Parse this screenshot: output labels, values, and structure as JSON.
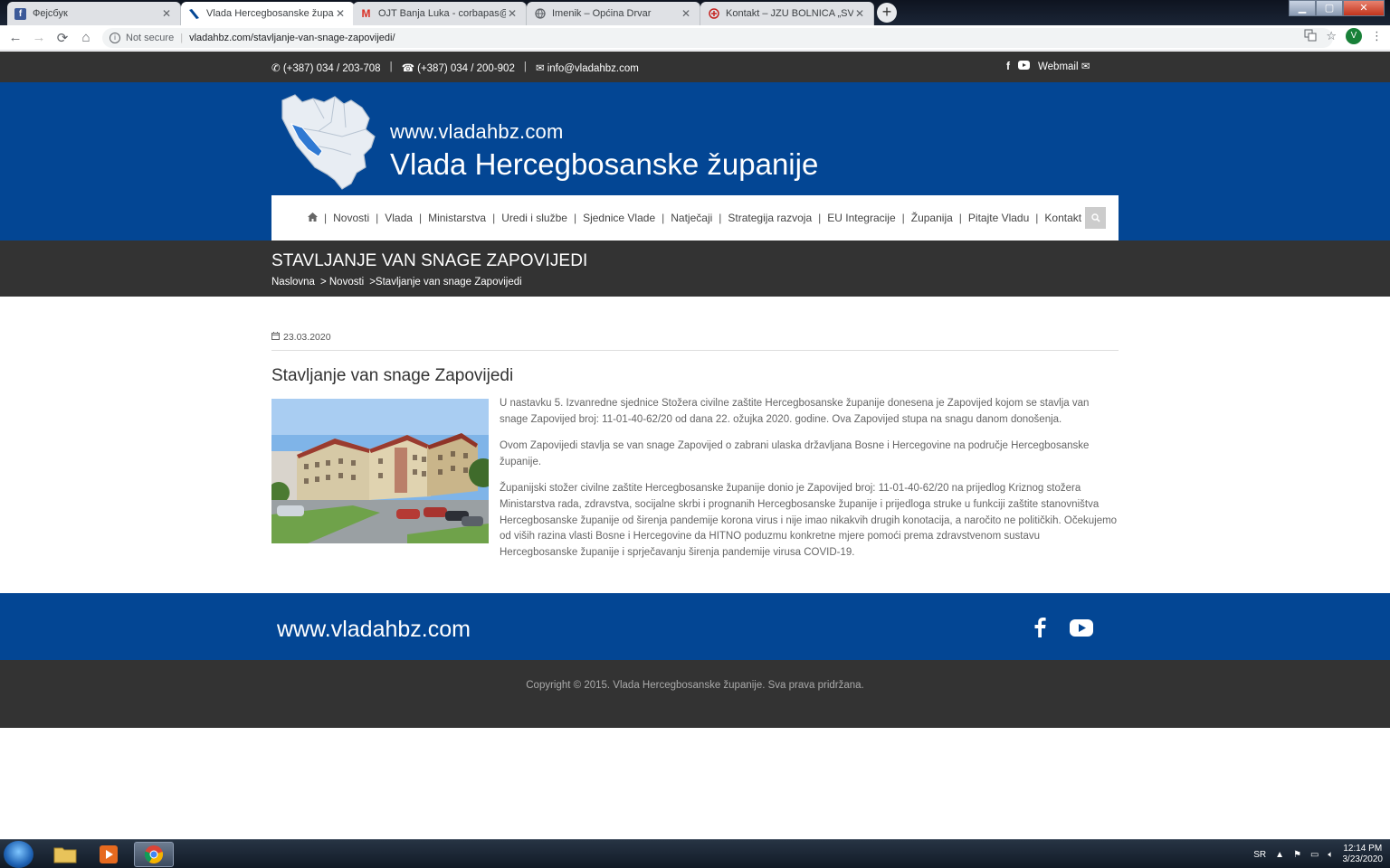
{
  "browser": {
    "tabs": [
      {
        "title": "Фејсбук",
        "icon": "facebook-icon"
      },
      {
        "title": "Vlada Hercegbosanske županije",
        "icon": "site-icon"
      },
      {
        "title": "OJT Banja Luka - corbapas@gma",
        "icon": "gmail-icon"
      },
      {
        "title": "Imenik – Općina Drvar",
        "icon": "globe-icon"
      },
      {
        "title": "Kontakt – JZU BOLNICA „SVETI V",
        "icon": "hospital-icon"
      }
    ],
    "security": "Not secure",
    "url": "vladahbz.com/stavljanje-van-snage-zapovijedi/",
    "profile_initial": "V"
  },
  "topbar": {
    "phone": "(+387) 034 / 203-708",
    "fax": "(+387) 034 / 200-902",
    "email": "info@vladahbz.com",
    "webmail": "Webmail"
  },
  "header": {
    "site_url": "www.vladahbz.com",
    "site_name": "Vlada Hercegbosanske županije"
  },
  "nav": {
    "items": [
      "Novosti",
      "Vlada",
      "Ministarstva",
      "Uredi i službe",
      "Sjednice Vlade",
      "Natječaji",
      "Strategija razvoja",
      "EU Integracije",
      "Županija",
      "Pitajte Vladu",
      "Kontakt"
    ]
  },
  "page": {
    "title": "STAVLJANJE VAN SNAGE ZAPOVIJEDI",
    "breadcrumbs": [
      "Naslovna",
      "> Novosti",
      ">Stavljanje van snage Zapovijedi"
    ]
  },
  "article": {
    "date": "23.03.2020",
    "title": "Stavljanje van snage Zapovijedi",
    "paragraphs": [
      "U nastavku 5. Izvanredne sjednice Stožera civilne zaštite Hercegbosanske županije donesena je Zapovijed kojom se stavlja van snage Zapovijed broj: 11-01-40-62/20 od dana 22. ožujka 2020. godine. Ova Zapovijed stupa na snagu danom donošenja.",
      "Ovom Zapovijedi stavlja se van snage Zapovijed o zabrani ulaska državljana Bosne i Hercegovine na područje Hercegbosanske županije.",
      "Županijski stožer civilne zaštite Hercegbosanske županije donio je Zapovijed broj: 11-01-40-62/20 na prijedlog Kriznog stožera Ministarstva rada, zdravstva, socijalne skrbi i prognanih Hercegbosanske županije i prijedloga struke u funkciji zaštite stanovništva Hercegbosanske županije od širenja pandemije korona virus i nije imao nikakvih drugih konotacija, a naročito ne političkih. Očekujemo od viših razina vlasti Bosne i Hercegovine da HITNO poduzmu konkretne mjere pomoći prema zdravstvenom sustavu Hercegbosanske županije i sprječavanju širenja pandemije virusa COVID-19."
    ]
  },
  "footer": {
    "site_url": "www.vladahbz.com",
    "copyright": "Copyright © 2015. Vlada Hercegbosanske županije. Sva prava pridržana."
  },
  "taskbar": {
    "lang": "SR",
    "time": "12:14 PM",
    "date": "3/23/2020"
  },
  "colors": {
    "brand_blue": "#034694",
    "dark_band": "#333333"
  }
}
